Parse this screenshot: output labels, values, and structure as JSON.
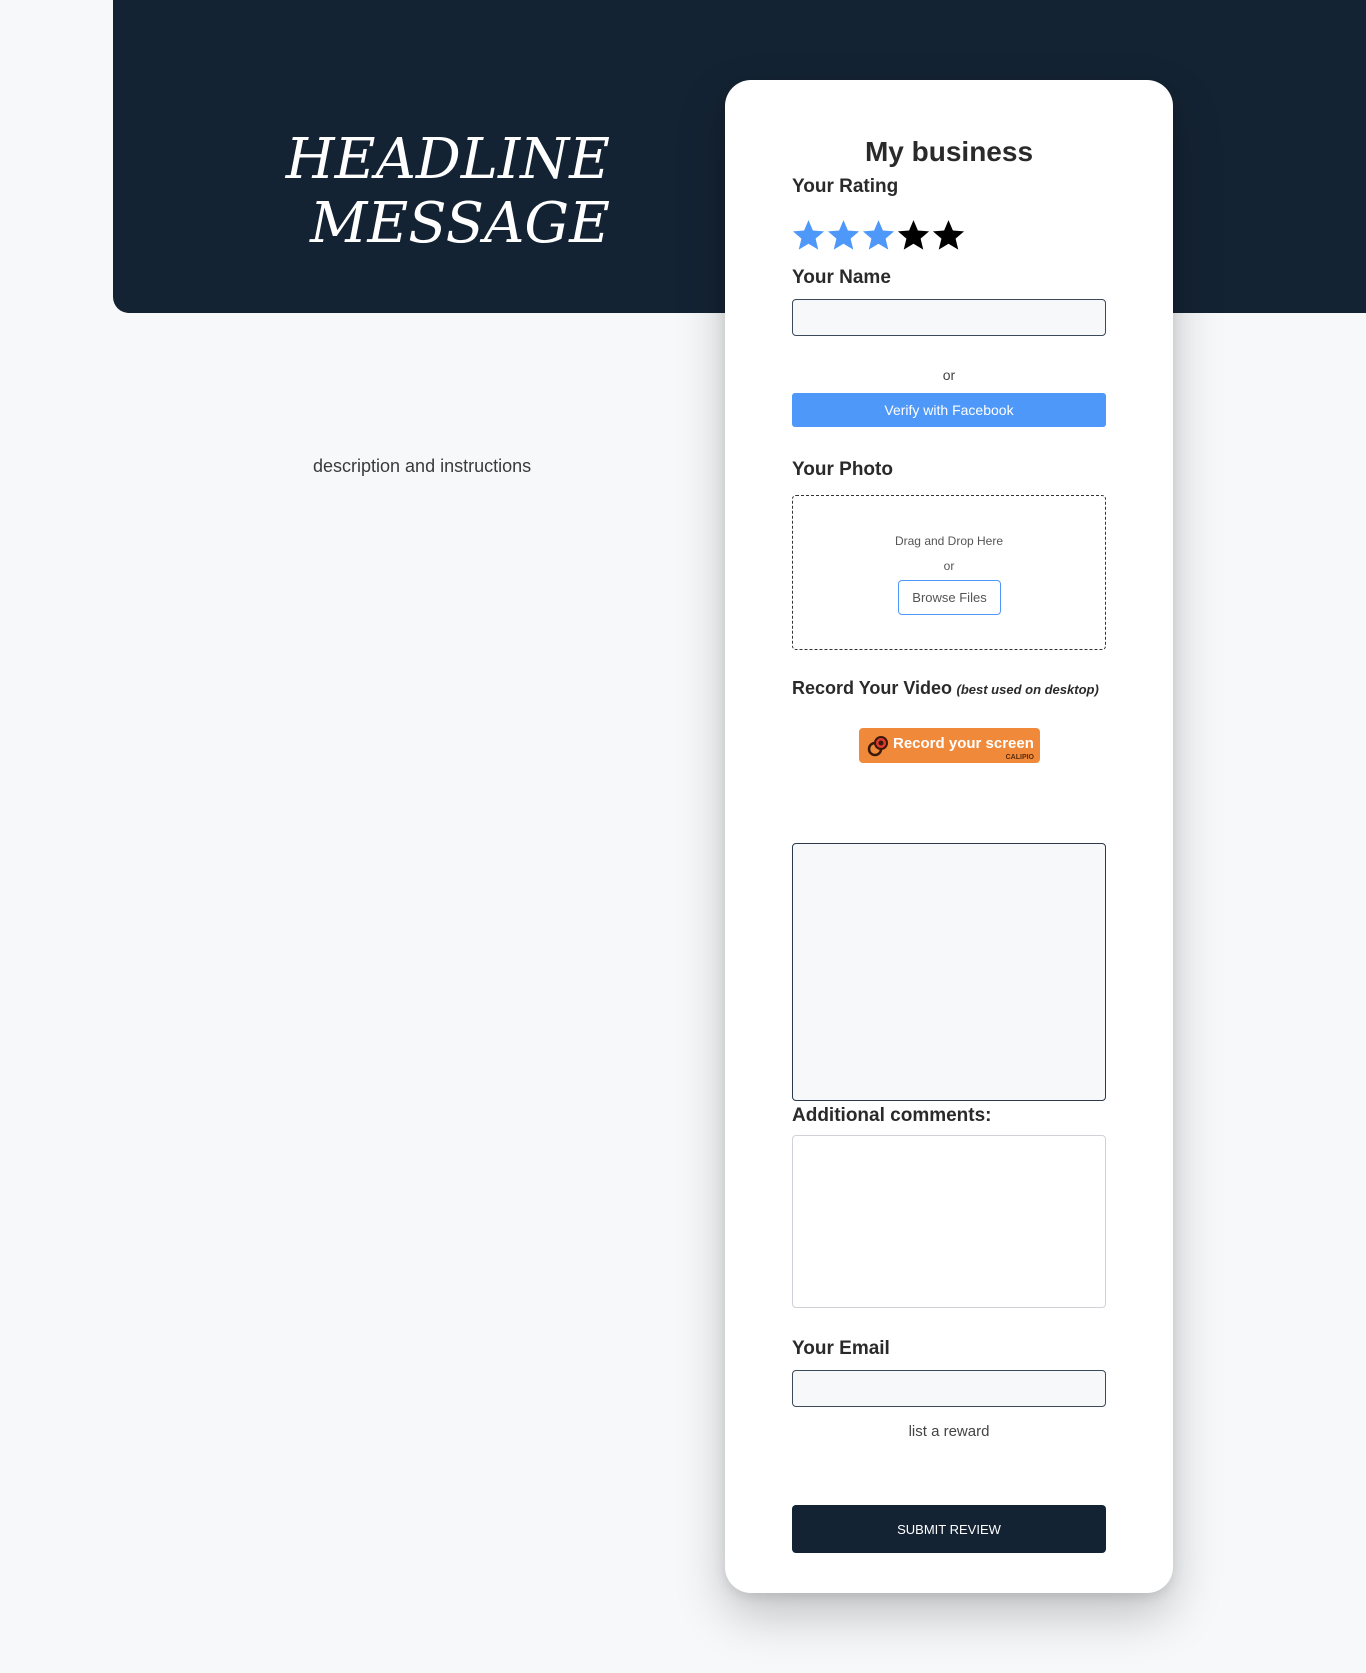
{
  "hero": {
    "headline_line1": "HEADLINE",
    "headline_line2": "MESSAGE",
    "background_color": "#142333"
  },
  "description": "description and instructions",
  "form": {
    "business_name": "My business",
    "rating": {
      "label": "Your Rating",
      "value": 3,
      "max": 5,
      "active_color": "#4e98f9",
      "inactive_color": "#000000",
      "icon": "star-icon"
    },
    "name": {
      "label": "Your Name",
      "value": "",
      "or_text": "or",
      "facebook_button": "Verify with Facebook"
    },
    "photo": {
      "label": "Your Photo",
      "drop_text": "Drag and Drop Here",
      "or_text": "or",
      "browse_button": "Browse Files"
    },
    "video": {
      "label": "Record Your Video",
      "note": "(best used on desktop)",
      "record_button": "Record your screen",
      "brand": "CALIPIO",
      "icon": "record-icon"
    },
    "comments": {
      "label": "Additional comments:",
      "value": ""
    },
    "email": {
      "label": "Your Email",
      "value": "",
      "reward_text": "list a reward"
    },
    "submit_button": "SUBMIT REVIEW"
  }
}
